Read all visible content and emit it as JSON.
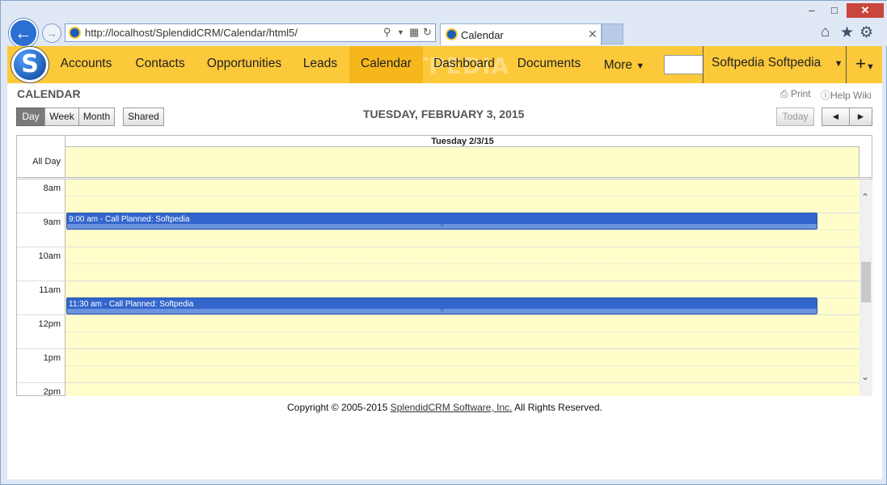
{
  "browser": {
    "window_controls": {
      "minimize": "–",
      "maximize": "□",
      "close": "✕"
    },
    "back_icon": "arrow-left-icon",
    "forward_icon": "arrow-right-icon",
    "address": "http://localhost/SplendidCRM/Calendar/html5/",
    "tab_title": "Calendar",
    "toolbar_icons": [
      "home-icon",
      "star-icon",
      "gear-icon"
    ]
  },
  "nav": {
    "logo_letter": "S",
    "items": [
      "Accounts",
      "Contacts",
      "Opportunities",
      "Leads",
      "Calendar",
      "Dashboard",
      "Documents"
    ],
    "active": "Calendar",
    "more_label": "More",
    "user_name": "Softpedia Softpedia",
    "plus_label": "+",
    "watermark": "SOFTPEDIA"
  },
  "module": {
    "title": "CALENDAR",
    "print_label": "Print",
    "help_label": "Help Wiki"
  },
  "view_buttons": {
    "day": "Day",
    "week": "Week",
    "month": "Month",
    "shared": "Shared"
  },
  "date_title": "TUESDAY, FEBRUARY 3, 2015",
  "nav_buttons": {
    "today": "Today",
    "prev": "◄",
    "next": "►"
  },
  "calendar": {
    "column_header": "Tuesday 2/3/15",
    "all_day_label": "All Day",
    "hours": [
      "8am",
      "9am",
      "10am",
      "11am",
      "12pm",
      "1pm",
      "2pm"
    ],
    "events": [
      {
        "label": "9:00 am - Call Planned: Softpedia"
      },
      {
        "label": "11:30 am - Call Planned: Softpedia"
      }
    ]
  },
  "footer": {
    "prefix": "Copyright © 2005-2015 ",
    "link": "SplendidCRM Software, Inc.",
    "suffix": " All Rights Reserved."
  },
  "colors": {
    "nav_bg": "#fcc93a",
    "nav_active": "#f6b71d",
    "grid_bg": "#fffecb",
    "event_bg": "#3366cc"
  }
}
